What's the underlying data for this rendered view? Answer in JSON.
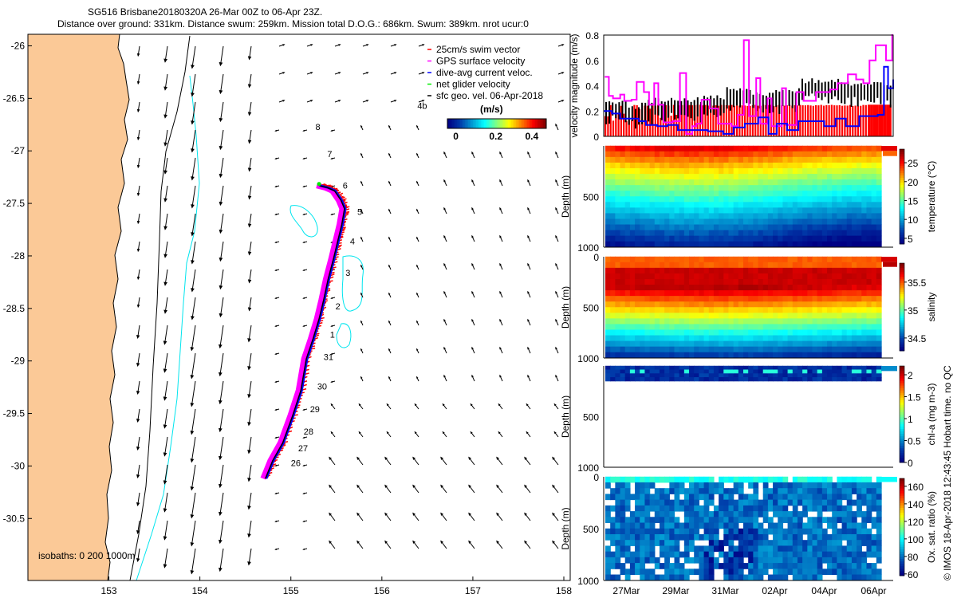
{
  "title": {
    "line1": "SG516 Brisbane20180320A 26-Mar 00Z to 06-Apr 23Z.",
    "line2": "Distance over ground: 331km. Distance swum: 259km. Mission total D.O.G.: 686km. Swum: 389km. nrot ucur:0"
  },
  "copyright": "© IMOS 18-Apr-2018 12:43:45 Hobart time. no QC",
  "colors": {
    "land": "#fbc997",
    "isobath_200": "#00e5ee",
    "isobath_1000": "#000000",
    "swim": "#ff0000",
    "gps": "#ff00ff",
    "dive_avg": "#0000ff",
    "net": "#00ee00"
  },
  "chart_data": [
    {
      "type": "map",
      "xlim": [
        152.11,
        158.07
      ],
      "ylim": [
        -31.09,
        -25.89
      ],
      "xticks": [
        "153",
        "154",
        "155",
        "156",
        "157",
        "158"
      ],
      "yticks": [
        "-26",
        "-26.5",
        "-27",
        "-27.5",
        "-28",
        "-28.5",
        "-29",
        "-29.5",
        "-30",
        "-30.5"
      ],
      "legend": [
        {
          "label": "25cm/s swim vector",
          "color": "#ff0000"
        },
        {
          "label": "GPS surface velocity",
          "color": "#ff00ff"
        },
        {
          "label": "dive-avg current veloc.",
          "color": "#0000ff"
        },
        {
          "label": "net glider velocity",
          "color": "#00ee00"
        },
        {
          "label": "sfc geo. vel. 06-Apr-2018",
          "color": "#000000"
        }
      ],
      "speed_colorbar": {
        "label": "(m/s)",
        "ticks": [
          "0",
          "0.2",
          "0.4"
        ],
        "range": [
          -0.05,
          0.5
        ]
      },
      "isobaths_label": "isobaths: 0   200  1000m",
      "track": {
        "lon": [
          154.72,
          154.8,
          154.91,
          155.02,
          155.11,
          155.17,
          155.24,
          155.31,
          155.36,
          155.41,
          155.47,
          155.52,
          155.56,
          155.59,
          155.55,
          155.48,
          155.4,
          155.31
        ],
        "lat": [
          -30.12,
          -29.95,
          -29.78,
          -29.52,
          -29.28,
          -28.98,
          -28.8,
          -28.6,
          -28.42,
          -28.22,
          -28.02,
          -27.84,
          -27.7,
          -27.55,
          -27.47,
          -27.38,
          -27.35,
          -27.33
        ]
      },
      "day_labels": [
        {
          "text": "26",
          "lon": 155.0,
          "lat": -30.0
        },
        {
          "text": "27",
          "lon": 155.08,
          "lat": -29.86
        },
        {
          "text": "28",
          "lon": 155.14,
          "lat": -29.7
        },
        {
          "text": "29",
          "lon": 155.21,
          "lat": -29.49
        },
        {
          "text": "30",
          "lon": 155.29,
          "lat": -29.27
        },
        {
          "text": "31",
          "lon": 155.36,
          "lat": -28.99
        },
        {
          "text": "1",
          "lon": 155.43,
          "lat": -28.78
        },
        {
          "text": "2",
          "lon": 155.49,
          "lat": -28.51
        },
        {
          "text": "3",
          "lon": 155.6,
          "lat": -28.19
        },
        {
          "text": "4",
          "lon": 155.65,
          "lat": -27.89
        },
        {
          "text": "5",
          "lon": 155.73,
          "lat": -27.61
        },
        {
          "text": "6",
          "lon": 155.57,
          "lat": -27.36
        },
        {
          "text": "7",
          "lon": 155.4,
          "lat": -27.06
        },
        {
          "text": "8",
          "lon": 155.27,
          "lat": -26.8
        },
        {
          "text": "4b",
          "lon": 156.39,
          "lat": -26.6
        }
      ]
    },
    {
      "type": "line",
      "ylabel": "velocity magnitude (m/s)",
      "ylim": [
        0,
        0.8
      ],
      "yticks": [
        "0",
        "0.2",
        "0.4",
        "0.6",
        "0.8"
      ],
      "xlim": [
        "2018-03-26T02:00Z",
        "2018-04-06T19:00Z"
      ],
      "xticks": [
        {
          "label": "27Mar",
          "date": "2018-03-27T00:00Z"
        },
        {
          "label": "29Mar",
          "date": "2018-03-29T00:00Z"
        },
        {
          "label": "31Mar",
          "date": "2018-03-31T00:00Z"
        },
        {
          "label": "02Apr",
          "date": "2018-04-02T00:00Z"
        },
        {
          "label": "04Apr",
          "date": "2018-04-04T00:00Z"
        },
        {
          "label": "06Apr",
          "date": "2018-04-06T00:00Z"
        }
      ],
      "series": [
        {
          "color": "#ff00ff",
          "x": [
            "2018-03-26T03:00Z",
            "2018-03-26T07:00Z",
            "2018-03-26T11:00Z",
            "2018-03-26T18:00Z",
            "2018-03-26T22:00Z",
            "2018-03-27T05:00Z",
            "2018-03-27T10:00Z",
            "2018-03-27T17:00Z",
            "2018-03-27T22:00Z",
            "2018-03-28T03:00Z",
            "2018-03-28T07:00Z",
            "2018-03-28T12:00Z",
            "2018-03-28T21:00Z",
            "2018-03-29T04:00Z",
            "2018-03-29T10:00Z",
            "2018-03-29T16:00Z",
            "2018-03-29T20:00Z",
            "2018-03-30T01:00Z",
            "2018-03-30T09:00Z",
            "2018-03-30T17:00Z",
            "2018-03-31T06:00Z",
            "2018-03-31T12:00Z",
            "2018-03-31T18:00Z",
            "2018-03-31T23:00Z",
            "2018-04-01T06:00Z",
            "2018-04-01T10:00Z",
            "2018-04-01T17:00Z",
            "2018-04-01T21:00Z",
            "2018-04-02T07:00Z",
            "2018-04-02T11:00Z",
            "2018-04-02T21:00Z",
            "2018-04-03T04:00Z",
            "2018-04-03T16:00Z",
            "2018-04-04T06:00Z",
            "2018-04-04T13:00Z",
            "2018-04-04T23:00Z",
            "2018-04-05T07:00Z",
            "2018-04-05T14:00Z",
            "2018-04-05T20:00Z",
            "2018-04-06T02:00Z",
            "2018-04-06T12:00Z",
            "2018-04-06T18:00Z"
          ],
          "values": [
            0.47,
            0.32,
            0.3,
            0.33,
            0.28,
            0.29,
            0.43,
            0.35,
            0.25,
            0.42,
            0.25,
            0.11,
            0.12,
            0.5,
            0.02,
            0.08,
            0.1,
            0.29,
            0.22,
            0.1,
            0.08,
            0.17,
            0.76,
            0.16,
            0.46,
            0.1,
            0.3,
            0.08,
            0.38,
            0.09,
            0.35,
            0.28,
            0.35,
            0.37,
            0.42,
            0.49,
            0.45,
            0.42,
            0.6,
            0.72,
            0.6,
            0.8
          ]
        },
        {
          "color": "#0000ff",
          "x": [
            "2018-03-26T02:00Z",
            "2018-03-26T10:00Z",
            "2018-03-26T18:00Z",
            "2018-03-27T01:00Z",
            "2018-03-27T12:00Z",
            "2018-03-27T19:00Z",
            "2018-03-28T06:00Z",
            "2018-03-28T16:00Z",
            "2018-03-29T02:00Z",
            "2018-03-29T15:00Z",
            "2018-03-30T07:00Z",
            "2018-03-30T22:00Z",
            "2018-03-31T08:00Z",
            "2018-03-31T19:00Z",
            "2018-04-01T08:00Z",
            "2018-04-01T18:00Z",
            "2018-04-02T02:00Z",
            "2018-04-02T12:00Z",
            "2018-04-02T23:00Z",
            "2018-04-03T11:00Z",
            "2018-04-04T00:00Z",
            "2018-04-04T11:00Z",
            "2018-04-04T21:00Z",
            "2018-04-05T10:00Z",
            "2018-04-06T04:00Z",
            "2018-04-06T10:00Z",
            "2018-04-06T14:00Z",
            "2018-04-06T19:00Z"
          ],
          "values": [
            0.2,
            0.18,
            0.14,
            0.14,
            0.12,
            0.09,
            0.08,
            0.09,
            0.05,
            0.05,
            0.04,
            0.02,
            0.07,
            0.1,
            0.15,
            0.02,
            0.1,
            0.05,
            0.12,
            0.12,
            0.08,
            0.14,
            0.08,
            0.16,
            0.17,
            0.55,
            0.38,
            0.45
          ]
        },
        {
          "color": "#000000",
          "x": [
            "2018-03-26T03:00Z",
            "2018-03-27T00:00Z",
            "2018-03-27T12:00Z",
            "2018-03-28T00:00Z",
            "2018-03-29T00:00Z",
            "2018-03-30T00:00Z",
            "2018-03-31T00:00Z",
            "2018-04-01T00:00Z",
            "2018-04-02T00:00Z",
            "2018-04-03T00:00Z",
            "2018-04-04T00:00Z",
            "2018-04-05T00:00Z",
            "2018-04-06T00:00Z",
            "2018-04-06T18:00Z"
          ],
          "values": [
            0.27,
            0.22,
            0.27,
            0.29,
            0.29,
            0.31,
            0.37,
            0.34,
            0.36,
            0.44,
            0.44,
            0.41,
            0.42,
            0.7
          ]
        },
        {
          "color": "#ff0000",
          "values_constant": 0.25
        }
      ]
    },
    {
      "type": "heatmap",
      "ylabel": "Depth (m)",
      "yticks": [
        "0",
        "500",
        "1000"
      ],
      "colorbar_label": "temperature (°C)",
      "colorbar_ticks": [
        "5",
        "10",
        "15",
        "20",
        "25"
      ],
      "clim": [
        3.5,
        28.6
      ],
      "surface": 26,
      "deep": 5
    },
    {
      "type": "heatmap",
      "ylabel": "Depth (m)",
      "yticks": [
        "0",
        "500",
        "1000"
      ],
      "colorbar_label": "salinity",
      "colorbar_ticks": [
        "34.5",
        "35",
        "35.5"
      ],
      "clim": [
        34.27,
        35.84
      ],
      "surface": 35.45,
      "max": 35.75,
      "deep": 34.4
    },
    {
      "type": "heatmap",
      "ylabel": "Depth (m)",
      "yticks": [
        "0",
        "500",
        "1000"
      ],
      "colorbar_label": "chl-a (mg m-3)",
      "colorbar_ticks": [
        "0",
        "0.5",
        "1",
        "1.5",
        "2"
      ],
      "clim": [
        0,
        2.2
      ]
    },
    {
      "type": "heatmap",
      "ylabel": "Depth (m)",
      "yticks": [
        "0",
        "500",
        "1000"
      ],
      "colorbar_label": "Ox. sat. ratio (%)",
      "colorbar_ticks": [
        "60",
        "80",
        "100",
        "120",
        "140",
        "160"
      ],
      "clim": [
        58,
        169
      ]
    }
  ]
}
